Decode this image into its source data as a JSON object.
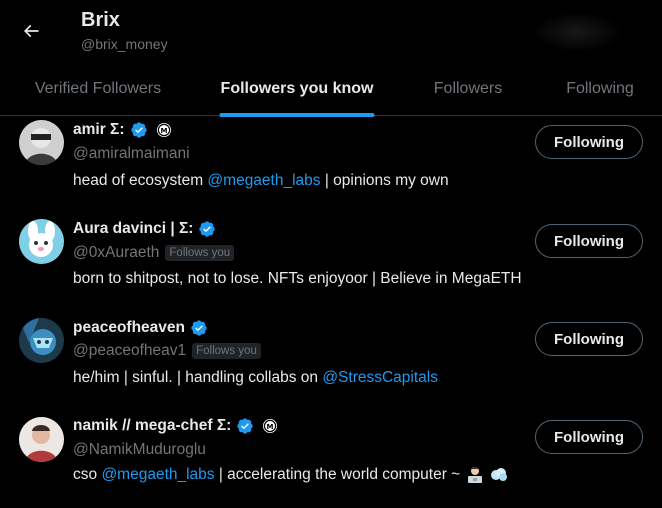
{
  "header": {
    "name": "Brix",
    "handle": "@brix_money",
    "back_icon": "arrow-left-icon"
  },
  "tabs": [
    {
      "label": "Verified Followers",
      "active": false
    },
    {
      "label": "Followers you know",
      "active": true
    },
    {
      "label": "Followers",
      "active": false
    },
    {
      "label": "Following",
      "active": false
    }
  ],
  "users": [
    {
      "name": "amir Σ:",
      "handle": "@amiralmaimani",
      "follows_you": false,
      "bio": {
        "before": "head of ecosystem ",
        "mention": "@megaeth_labs",
        "after": " | opinions my own"
      },
      "button": "Following",
      "badges": [
        "verified-icon",
        "mega-badge-icon"
      ]
    },
    {
      "name": "Aura davinci | Σ:",
      "handle": "@0xAuraeth",
      "follows_you": true,
      "follows_you_label": "Follows you",
      "bio": {
        "text": "born to shitpost, not to lose. NFTs enjoyoor | Believe in MegaETH"
      },
      "button": "Following",
      "badges": [
        "verified-icon"
      ]
    },
    {
      "name": "peaceofheaven",
      "handle": "@peaceofheav1",
      "follows_you": true,
      "follows_you_label": "Follows you",
      "bio": {
        "before": "he/him | sinful. | handling collabs on ",
        "mention": "@StressCapitals",
        "after": ""
      },
      "button": "Following",
      "badges": [
        "verified-icon"
      ]
    },
    {
      "name": "namik // mega-chef Σ:",
      "handle": "@NamikMuduroglu",
      "follows_you": false,
      "bio": {
        "before": "cso ",
        "mention": "@megaeth_labs",
        "after": " | accelerating the world computer ~ "
      },
      "button": "Following",
      "badges": [
        "verified-icon",
        "mega-badge-icon"
      ]
    }
  ],
  "colors": {
    "accent": "#1d9bf0",
    "background": "#000000",
    "text": "#e7e9ea",
    "muted": "#71767b"
  }
}
